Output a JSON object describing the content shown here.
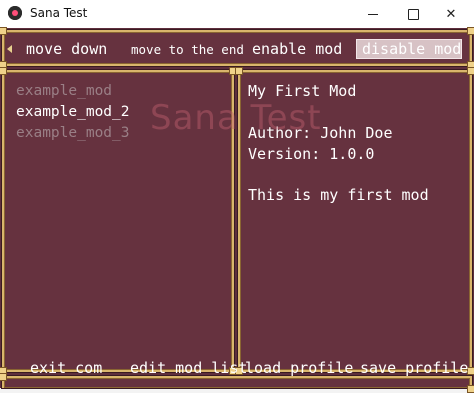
{
  "window": {
    "title": "Sana Test",
    "controls": {
      "minimize": "minimize",
      "maximize": "maximize",
      "close": "✕"
    }
  },
  "commands": {
    "move_down": "move down",
    "move_to_end": "move to the end",
    "enable_mod": "enable mod",
    "disable_mod": "disable mod",
    "selected": "disable mod"
  },
  "mod_list": {
    "items": [
      {
        "label": "example_mod",
        "state": "dim"
      },
      {
        "label": "example_mod_2",
        "state": "active"
      },
      {
        "label": "example_mod_3",
        "state": "dim"
      }
    ]
  },
  "watermark": "Sana Test",
  "mod_info": {
    "name": "My First Mod",
    "author": "Author: John Doe",
    "version": "Version: 1.0.0",
    "description": "This is my first mod"
  },
  "bottom_commands": {
    "exit": "exit com",
    "edit_mod_list": "edit mod list",
    "load_profile": "load profile",
    "save_profile": "save profile"
  },
  "colors": {
    "background": "#5e2f3d",
    "panel": "#66323f",
    "border_gold": "#d9b56c",
    "selected_highlight": "#d7c2c5",
    "text": "#ffffff",
    "text_dim": "#9a7f86"
  },
  "icons": {
    "app": "app-icon",
    "scroll_left": "arrow-left-icon"
  }
}
